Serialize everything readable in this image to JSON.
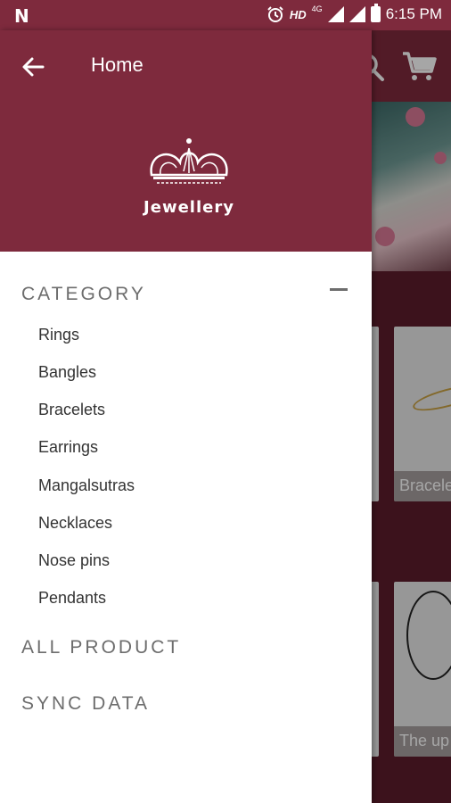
{
  "status_bar": {
    "carrier_logo": "N",
    "alarm_icon": "alarm-icon",
    "hd_label": "HD",
    "network_label": "4G",
    "time": "6:15 PM"
  },
  "toolbar": {
    "title": "Home",
    "back_icon": "back-arrow-icon",
    "search_icon": "search-icon",
    "cart_icon": "cart-icon"
  },
  "drawer": {
    "logo_text": "Jewellery",
    "category_title": "CATEGORY",
    "categories": [
      "Rings",
      "Bangles",
      "Bracelets",
      "Earrings",
      "Mangalsutras",
      "Necklaces",
      "Nose pins",
      "Pendants"
    ],
    "all_product_label": "ALL PRODUCT",
    "sync_data_label": "SYNC DATA"
  },
  "background_cards": {
    "card1_caption": "Bracele",
    "card2_caption": "The up"
  },
  "colors": {
    "primary": "#7e2a3d",
    "drawer_bg": "#ffffff",
    "section_text": "#6d6d6d"
  }
}
